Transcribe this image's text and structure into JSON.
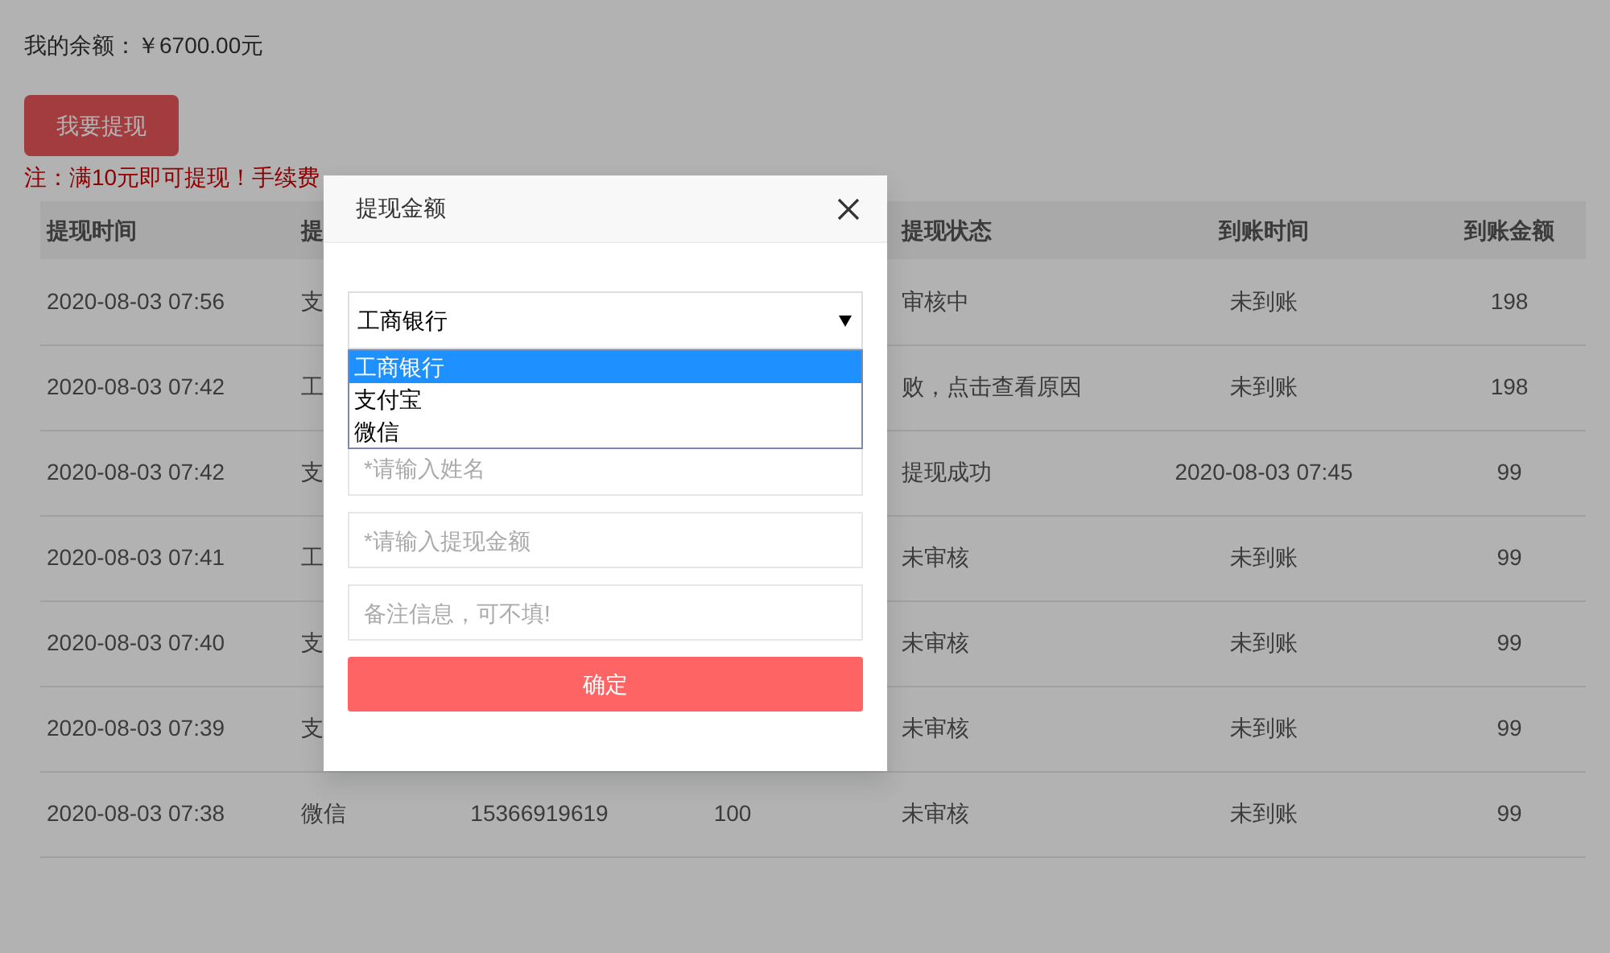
{
  "balance": "我的余额：￥6700.00元",
  "withdraw_button": "我要提现",
  "note": "注：满10元即可提现！手续费",
  "table": {
    "header": {
      "time": "提现时间",
      "column_2": "提",
      "status": "提现状态",
      "arrival_time": "到账时间",
      "amount": "到账金额"
    },
    "rows": [
      {
        "time": "2020-08-03 07:56",
        "column_2": "支",
        "status": "审核中",
        "arrival_time": "未到账",
        "amount": "198"
      },
      {
        "time": "2020-08-03 07:42",
        "column_2": "工",
        "status": "败，点击查看原因",
        "arrival_time": "未到账",
        "amount": "198"
      },
      {
        "time": "2020-08-03 07:42",
        "column_2": "支",
        "status": "提现成功",
        "arrival_time": "2020-08-03 07:45",
        "amount": "99"
      },
      {
        "time": "2020-08-03 07:41",
        "column_2": "工",
        "status": "未审核",
        "arrival_time": "未到账",
        "amount": "99"
      },
      {
        "time": "2020-08-03 07:40",
        "column_2": "支",
        "status": "未审核",
        "arrival_time": "未到账",
        "amount": "99"
      },
      {
        "time": "2020-08-03 07:39",
        "column_2": "支",
        "status": "未审核",
        "arrival_time": "未到账",
        "amount": "99"
      },
      {
        "time": "2020-08-03 07:38",
        "column_2": "微信",
        "column_3": "15366919619",
        "column_4": "100",
        "status": "未审核",
        "arrival_time": "未到账",
        "amount": "99"
      }
    ]
  },
  "modal": {
    "title": "提现金额",
    "method_select": {
      "value": "工商银行",
      "expanded": true,
      "options": [
        {
          "label": "工商银行",
          "selected": true
        },
        {
          "label": "支付宝",
          "selected": false
        },
        {
          "label": "微信",
          "selected": false
        }
      ]
    },
    "fields": [
      {
        "placeholder": "*请输入姓名"
      },
      {
        "placeholder": "*请输入提现金额"
      },
      {
        "placeholder": "备注信息，可不填!"
      }
    ],
    "confirm_button": "确定"
  }
}
